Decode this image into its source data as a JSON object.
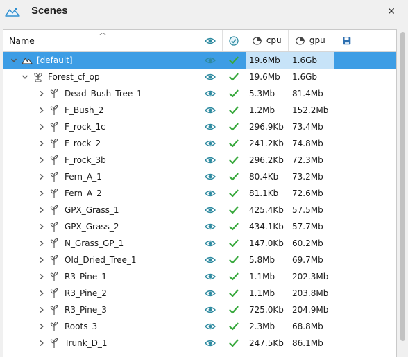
{
  "panel": {
    "title": "Scenes",
    "icons": {
      "app": "mountain-scene-icon",
      "close": "close-icon"
    },
    "close_glyph": "✕"
  },
  "columns": {
    "name": "Name",
    "visibility_icon": "eye-icon",
    "enabled_icon": "check-circle-icon",
    "cpu": "cpu",
    "gpu": "gpu",
    "save_icon": "save-icon"
  },
  "colors": {
    "selection": "#3d9de5",
    "eye": "#2d8aa0",
    "check": "#37a83c"
  },
  "tree": [
    {
      "name": "[default]",
      "level": 0,
      "type": "scene",
      "expanded": true,
      "selected": true,
      "cpu": "19.6Mb",
      "gpu": "1.6Gb",
      "visible": true,
      "enabled": true
    },
    {
      "name": "Forest_cf_op",
      "level": 1,
      "type": "group",
      "expanded": true,
      "selected": false,
      "cpu": "19.6Mb",
      "gpu": "1.6Gb",
      "visible": true,
      "enabled": true
    },
    {
      "name": "Dead_Bush_Tree_1",
      "level": 2,
      "type": "plant",
      "expanded": false,
      "cpu": "5.3Mb",
      "gpu": "81.4Mb",
      "visible": true,
      "enabled": true
    },
    {
      "name": "F_Bush_2",
      "level": 2,
      "type": "plant",
      "expanded": false,
      "cpu": "1.2Mb",
      "gpu": "152.2Mb",
      "visible": true,
      "enabled": true
    },
    {
      "name": "F_rock_1c",
      "level": 2,
      "type": "plant",
      "expanded": false,
      "cpu": "296.9Kb",
      "gpu": "73.4Mb",
      "visible": true,
      "enabled": true
    },
    {
      "name": "F_rock_2",
      "level": 2,
      "type": "plant",
      "expanded": false,
      "cpu": "241.2Kb",
      "gpu": "74.8Mb",
      "visible": true,
      "enabled": true
    },
    {
      "name": "F_rock_3b",
      "level": 2,
      "type": "plant",
      "expanded": false,
      "cpu": "296.2Kb",
      "gpu": "72.3Mb",
      "visible": true,
      "enabled": true
    },
    {
      "name": "Fern_A_1",
      "level": 2,
      "type": "plant",
      "expanded": false,
      "cpu": "80.4Kb",
      "gpu": "73.2Mb",
      "visible": true,
      "enabled": true
    },
    {
      "name": "Fern_A_2",
      "level": 2,
      "type": "plant",
      "expanded": false,
      "cpu": "81.1Kb",
      "gpu": "72.6Mb",
      "visible": true,
      "enabled": true
    },
    {
      "name": "GPX_Grass_1",
      "level": 2,
      "type": "plant",
      "expanded": false,
      "cpu": "425.4Kb",
      "gpu": "57.5Mb",
      "visible": true,
      "enabled": true
    },
    {
      "name": "GPX_Grass_2",
      "level": 2,
      "type": "plant",
      "expanded": false,
      "cpu": "434.1Kb",
      "gpu": "57.7Mb",
      "visible": true,
      "enabled": true
    },
    {
      "name": "N_Grass_GP_1",
      "level": 2,
      "type": "plant",
      "expanded": false,
      "cpu": "147.0Kb",
      "gpu": "60.2Mb",
      "visible": true,
      "enabled": true
    },
    {
      "name": "Old_Dried_Tree_1",
      "level": 2,
      "type": "plant",
      "expanded": false,
      "cpu": "5.8Mb",
      "gpu": "69.7Mb",
      "visible": true,
      "enabled": true
    },
    {
      "name": "R3_Pine_1",
      "level": 2,
      "type": "plant",
      "expanded": false,
      "cpu": "1.1Mb",
      "gpu": "202.3Mb",
      "visible": true,
      "enabled": true
    },
    {
      "name": "R3_Pine_2",
      "level": 2,
      "type": "plant",
      "expanded": false,
      "cpu": "1.1Mb",
      "gpu": "203.8Mb",
      "visible": true,
      "enabled": true
    },
    {
      "name": "R3_Pine_3",
      "level": 2,
      "type": "plant",
      "expanded": false,
      "cpu": "725.0Kb",
      "gpu": "204.9Mb",
      "visible": true,
      "enabled": true
    },
    {
      "name": "Roots_3",
      "level": 2,
      "type": "plant",
      "expanded": false,
      "cpu": "2.3Mb",
      "gpu": "68.8Mb",
      "visible": true,
      "enabled": true
    },
    {
      "name": "Trunk_D_1",
      "level": 2,
      "type": "plant",
      "expanded": false,
      "cpu": "247.5Kb",
      "gpu": "86.1Mb",
      "visible": true,
      "enabled": true
    }
  ]
}
